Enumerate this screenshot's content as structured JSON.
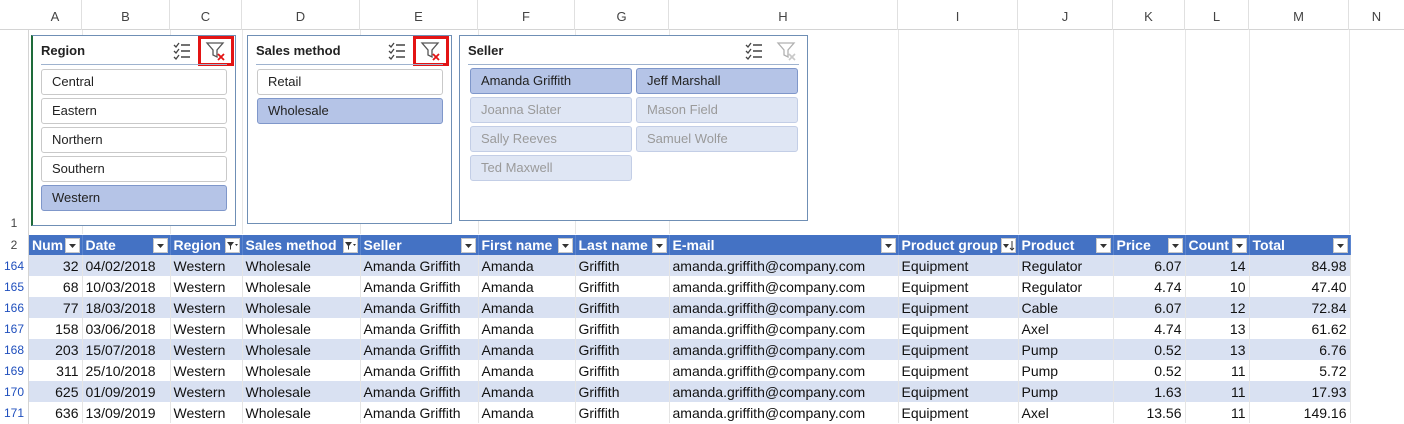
{
  "columns": [
    "A",
    "B",
    "C",
    "D",
    "E",
    "F",
    "G",
    "H",
    "I",
    "J",
    "K",
    "L",
    "M",
    "N"
  ],
  "row_numbers": {
    "slicer_row": "1",
    "header_row": "2",
    "data_rows": [
      "164",
      "165",
      "166",
      "167",
      "168",
      "169",
      "170",
      "171"
    ]
  },
  "slicers": {
    "region": {
      "title": "Region",
      "items": [
        {
          "label": "Central",
          "state": "normal"
        },
        {
          "label": "Eastern",
          "state": "normal"
        },
        {
          "label": "Northern",
          "state": "normal"
        },
        {
          "label": "Southern",
          "state": "normal"
        },
        {
          "label": "Western",
          "state": "selected"
        }
      ]
    },
    "sales_method": {
      "title": "Sales method",
      "items": [
        {
          "label": "Retail",
          "state": "normal"
        },
        {
          "label": "Wholesale",
          "state": "selected"
        }
      ]
    },
    "seller": {
      "title": "Seller",
      "items": [
        {
          "label": "Amanda Griffith",
          "state": "selected"
        },
        {
          "label": "Jeff Marshall",
          "state": "selected"
        },
        {
          "label": "Joanna Slater",
          "state": "unavailable"
        },
        {
          "label": "Mason Field",
          "state": "unavailable"
        },
        {
          "label": "Sally Reeves",
          "state": "unavailable"
        },
        {
          "label": "Samuel Wolfe",
          "state": "unavailable"
        },
        {
          "label": "Ted Maxwell",
          "state": "unavailable"
        }
      ]
    }
  },
  "table": {
    "headers": [
      "Num",
      "Date",
      "Region",
      "Sales method",
      "Seller",
      "First name",
      "Last name",
      "E-mail",
      "Product group",
      "Product",
      "Price",
      "Count",
      "Total"
    ],
    "rows": [
      [
        "32",
        "04/02/2018",
        "Western",
        "Wholesale",
        "Amanda Griffith",
        "Amanda",
        "Griffith",
        "amanda.griffith@company.com",
        "Equipment",
        "Regulator",
        "6.07",
        "14",
        "84.98"
      ],
      [
        "68",
        "10/03/2018",
        "Western",
        "Wholesale",
        "Amanda Griffith",
        "Amanda",
        "Griffith",
        "amanda.griffith@company.com",
        "Equipment",
        "Regulator",
        "4.74",
        "10",
        "47.40"
      ],
      [
        "77",
        "18/03/2018",
        "Western",
        "Wholesale",
        "Amanda Griffith",
        "Amanda",
        "Griffith",
        "amanda.griffith@company.com",
        "Equipment",
        "Cable",
        "6.07",
        "12",
        "72.84"
      ],
      [
        "158",
        "03/06/2018",
        "Western",
        "Wholesale",
        "Amanda Griffith",
        "Amanda",
        "Griffith",
        "amanda.griffith@company.com",
        "Equipment",
        "Axel",
        "4.74",
        "13",
        "61.62"
      ],
      [
        "203",
        "15/07/2018",
        "Western",
        "Wholesale",
        "Amanda Griffith",
        "Amanda",
        "Griffith",
        "amanda.griffith@company.com",
        "Equipment",
        "Pump",
        "0.52",
        "13",
        "6.76"
      ],
      [
        "311",
        "25/10/2018",
        "Western",
        "Wholesale",
        "Amanda Griffith",
        "Amanda",
        "Griffith",
        "amanda.griffith@company.com",
        "Equipment",
        "Pump",
        "0.52",
        "11",
        "5.72"
      ],
      [
        "625",
        "01/09/2019",
        "Western",
        "Wholesale",
        "Amanda Griffith",
        "Amanda",
        "Griffith",
        "amanda.griffith@company.com",
        "Equipment",
        "Pump",
        "1.63",
        "11",
        "17.93"
      ],
      [
        "636",
        "13/09/2019",
        "Western",
        "Wholesale",
        "Amanda Griffith",
        "Amanda",
        "Griffith",
        "amanda.griffith@company.com",
        "Equipment",
        "Axel",
        "13.56",
        "11",
        "149.16"
      ]
    ]
  },
  "colors": {
    "header_blue": "#4472c4",
    "band_blue": "#d9e1f2",
    "slicer_selected": "#b5c4e7",
    "highlight_red": "#e31414"
  }
}
